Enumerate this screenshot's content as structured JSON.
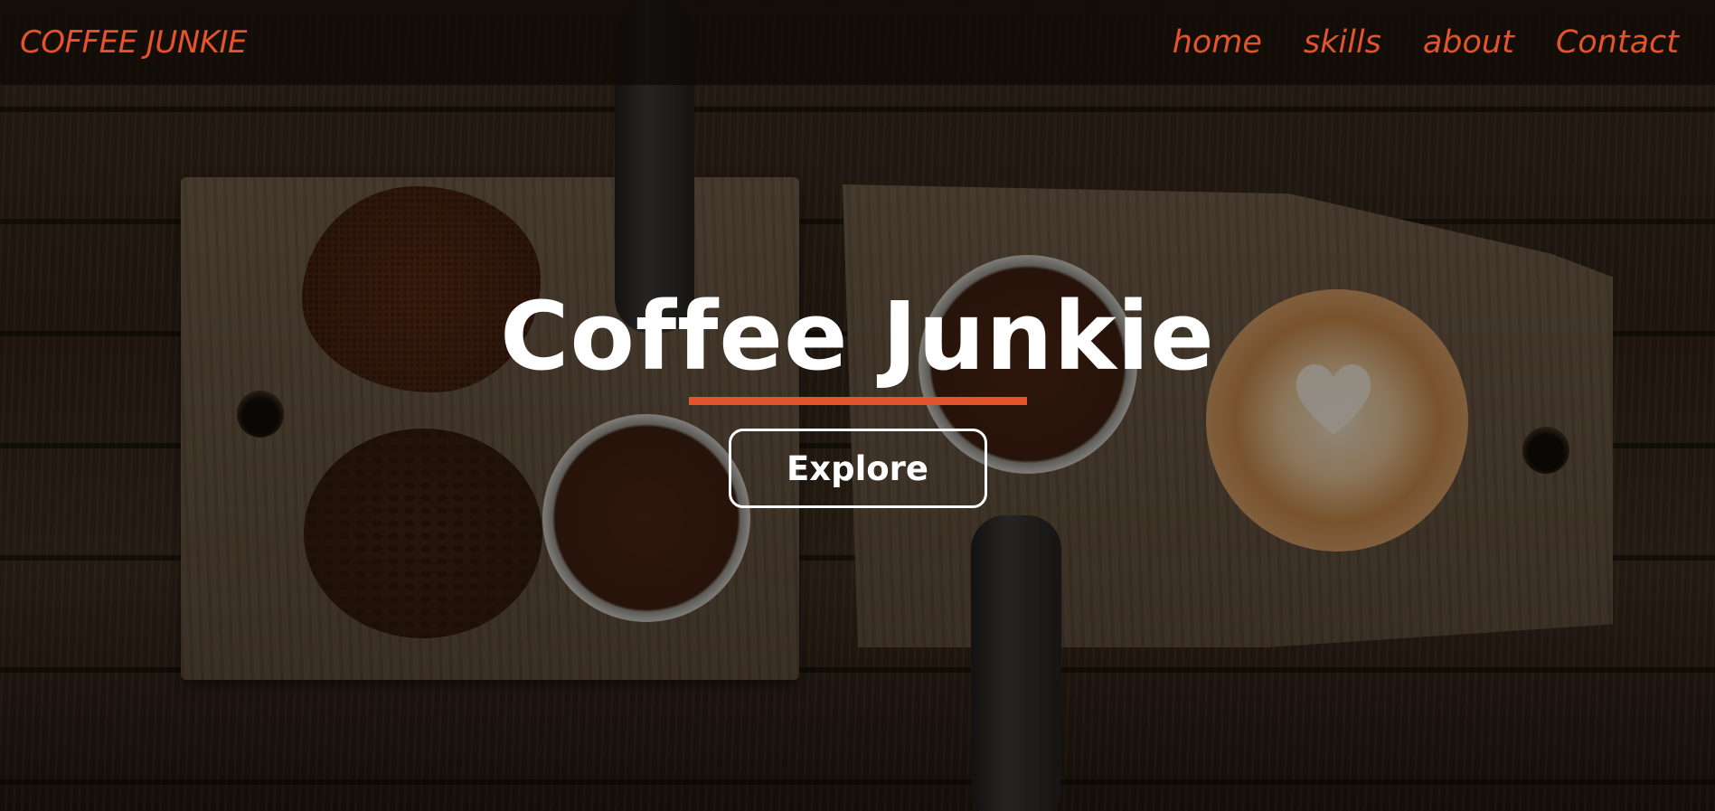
{
  "navbar": {
    "brand": "COFFEE JUNKIE",
    "links": [
      {
        "label": "home"
      },
      {
        "label": "skills"
      },
      {
        "label": "about"
      },
      {
        "label": "Contact"
      }
    ]
  },
  "hero": {
    "title": "Coffee Junkie",
    "cta_label": "Explore"
  },
  "colors": {
    "accent": "#e4542b",
    "text_light": "#ffffff",
    "overlay": "#0a0603"
  }
}
